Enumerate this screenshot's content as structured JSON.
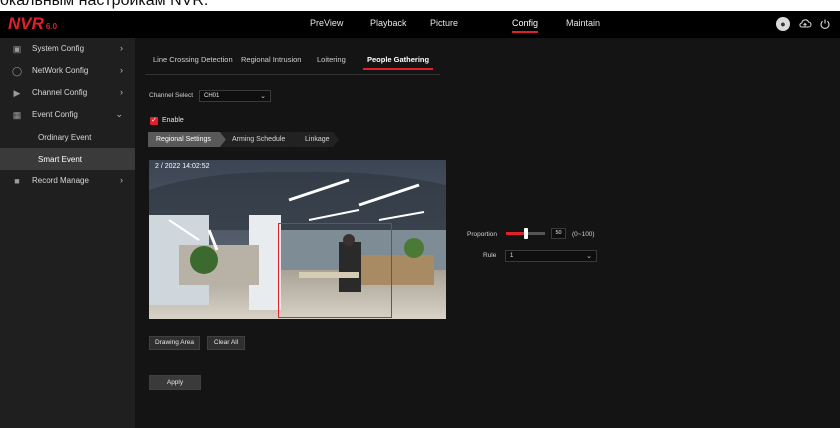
{
  "caption": "окальным настройкам NVR.",
  "app": {
    "logo": "NVR",
    "version": "6.0"
  },
  "topnav": [
    {
      "label": "PreView"
    },
    {
      "label": "Playback"
    },
    {
      "label": "Picture"
    },
    {
      "label": "Config",
      "active": true
    },
    {
      "label": "Maintain"
    }
  ],
  "top_icons": [
    "user-icon",
    "cloud-icon",
    "power-icon"
  ],
  "sidebar": {
    "items": [
      {
        "label": "System Config",
        "icon": "monitor-icon"
      },
      {
        "label": "NetWork Config",
        "icon": "globe-icon"
      },
      {
        "label": "Channel Config",
        "icon": "camera-icon"
      },
      {
        "label": "Event Config",
        "icon": "calendar-icon",
        "expanded": true
      },
      {
        "label": "Record Manage",
        "icon": "record-icon"
      }
    ],
    "subitems": [
      {
        "label": "Ordinary Event"
      },
      {
        "label": "Smart Event",
        "active": true
      }
    ]
  },
  "tabs": [
    {
      "label": "Line Crossing Detection"
    },
    {
      "label": "Regional Intrusion"
    },
    {
      "label": "Loitering"
    },
    {
      "label": "People Gathering",
      "active": true
    }
  ],
  "channel": {
    "label": "Channel Select",
    "value": "CH01"
  },
  "enable": {
    "label": "Enable",
    "checked": true
  },
  "subtabs": [
    {
      "label": "Regional Settings",
      "active": true
    },
    {
      "label": "Arming Schedule"
    },
    {
      "label": "Linkage"
    }
  ],
  "video": {
    "osd": "2 / 2022 14:02:52"
  },
  "buttons": {
    "drawing_area": "Drawing Area",
    "clear_all": "Clear All",
    "apply": "Apply"
  },
  "proportion": {
    "label": "Proportion",
    "value": "50",
    "range": "(0~100)",
    "fraction": 0.5
  },
  "rule": {
    "label": "Rule",
    "value": "1"
  },
  "colors": {
    "accent": "#e0202a",
    "background": "#141414",
    "sidebar": "#1f1f1f"
  }
}
